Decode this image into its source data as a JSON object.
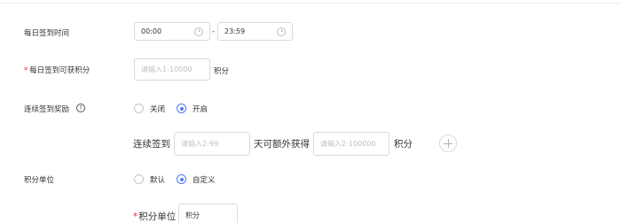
{
  "rows": {
    "daily_time": {
      "label": "每日签到时间",
      "start_value": "00:00",
      "separator": "-",
      "end_value": "23:59"
    },
    "daily_points": {
      "required_mark": "*",
      "label": "每日签到可获积分",
      "placeholder": "请输入1-10000",
      "unit": "积分"
    },
    "streak_reward": {
      "label": "连续签到奖励",
      "help_glyph": "?",
      "options": [
        "关闭",
        "开启"
      ],
      "selected": "开启",
      "rule": {
        "prefix": "连续签到",
        "days_placeholder": "请输入2-99",
        "middle": "天可额外获得",
        "points_placeholder": "请输入2-100000",
        "unit": "积分"
      }
    },
    "points_unit": {
      "label": "积分单位",
      "options": [
        "默认",
        "自定义"
      ],
      "selected": "自定义",
      "custom": {
        "required_mark": "*",
        "label": "积分单位",
        "value": "积分"
      }
    }
  }
}
